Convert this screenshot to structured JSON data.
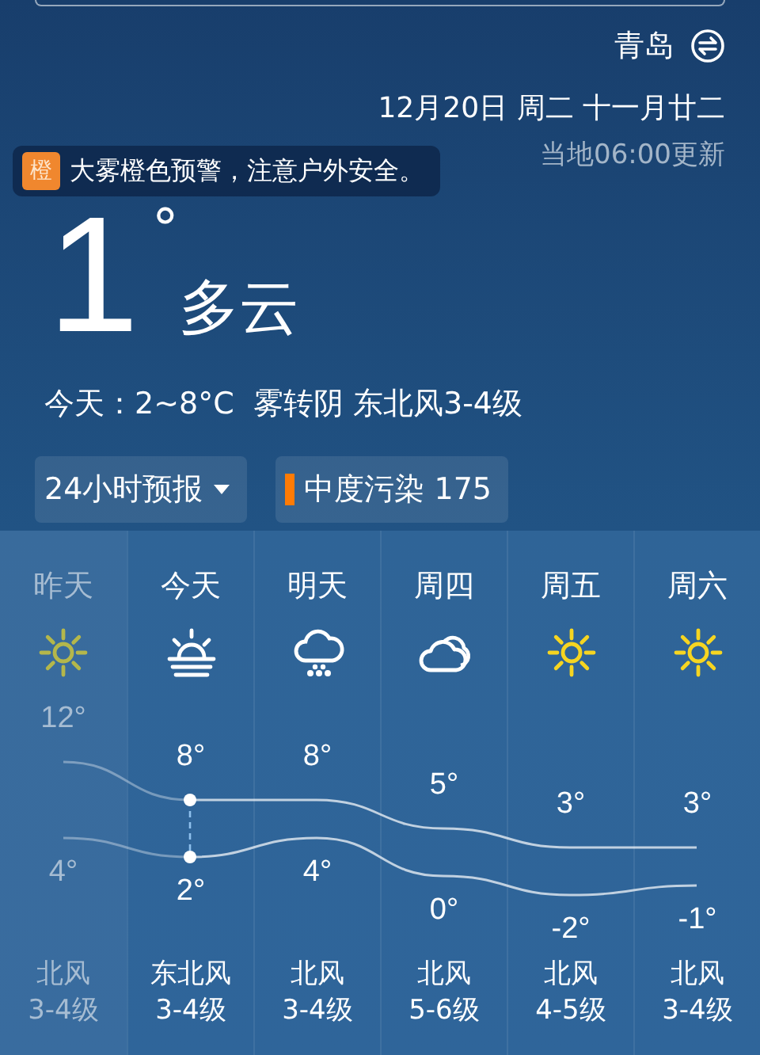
{
  "city": {
    "name": "青岛"
  },
  "date": "12月20日 周二 十一月廿二",
  "updated": "当地06:00更新",
  "alert": {
    "badge": "橙",
    "text": "大雾橙色预警，注意户外安全。"
  },
  "current": {
    "temperature": "1",
    "degree": "°",
    "condition": "多云",
    "summary": "今天：2~8°C  雾转阴 东北风3-4级"
  },
  "buttons": [
    {
      "label": "24小时预报",
      "kind": "dropdown"
    },
    {
      "label": "中度污染 175",
      "kind": "aqi"
    }
  ],
  "forecast": [
    {
      "day": "昨天",
      "past": true,
      "today": false,
      "kind": "sun",
      "high": "12°",
      "low": "4°",
      "wind": "北风",
      "wind_level": "3-4级"
    },
    {
      "day": "今天",
      "past": false,
      "today": true,
      "kind": "fog",
      "high": "8°",
      "low": "2°",
      "wind": "东北风",
      "wind_level": "3-4级"
    },
    {
      "day": "明天",
      "past": false,
      "today": false,
      "kind": "rain",
      "high": "8°",
      "low": "4°",
      "wind": "北风",
      "wind_level": "3-4级"
    },
    {
      "day": "周四",
      "past": false,
      "today": false,
      "kind": "cloud",
      "high": "5°",
      "low": "0°",
      "wind": "北风",
      "wind_level": "5-6级"
    },
    {
      "day": "周五",
      "past": false,
      "today": false,
      "kind": "sun",
      "high": "3°",
      "low": "-2°",
      "wind": "北风",
      "wind_level": "4-5级"
    },
    {
      "day": "周六",
      "past": false,
      "today": false,
      "kind": "sun",
      "high": "3°",
      "low": "-1°",
      "wind": "北风",
      "wind_level": "3-4级"
    }
  ]
}
